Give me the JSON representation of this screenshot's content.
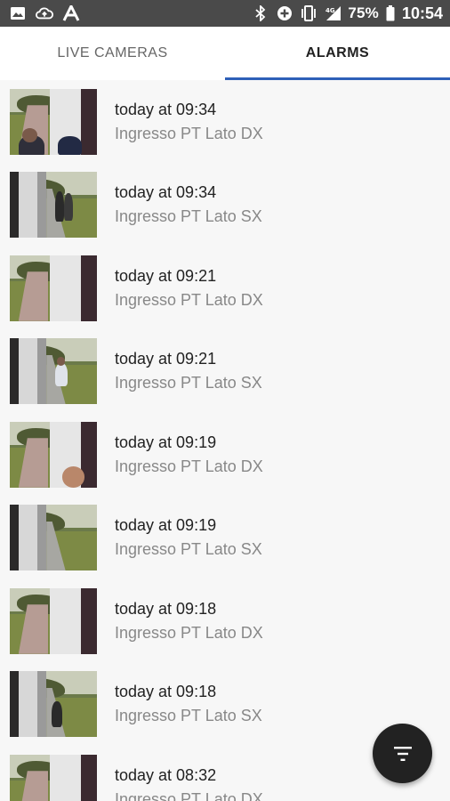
{
  "status_bar": {
    "battery_percent": "75%",
    "time": "10:54",
    "icons": [
      "image-icon",
      "cloud-upload-icon",
      "font-a-icon",
      "bluetooth-icon",
      "data-saver-icon",
      "vibrate-icon",
      "signal-4g-icon",
      "battery-icon"
    ]
  },
  "tabs": [
    {
      "label": "LIVE CAMERAS",
      "active": false
    },
    {
      "label": "ALARMS",
      "active": true
    }
  ],
  "alarms": [
    {
      "time": "today at 09:34",
      "camera": "Ingresso PT Lato DX",
      "side": "dx"
    },
    {
      "time": "today at 09:34",
      "camera": "Ingresso PT Lato SX",
      "side": "sx"
    },
    {
      "time": "today at 09:21",
      "camera": "Ingresso PT Lato DX",
      "side": "dx"
    },
    {
      "time": "today at 09:21",
      "camera": "Ingresso PT Lato SX",
      "side": "sx"
    },
    {
      "time": "today at 09:19",
      "camera": "Ingresso PT Lato DX",
      "side": "dx"
    },
    {
      "time": "today at 09:19",
      "camera": "Ingresso PT Lato SX",
      "side": "sx"
    },
    {
      "time": "today at 09:18",
      "camera": "Ingresso PT Lato DX",
      "side": "dx"
    },
    {
      "time": "today at 09:18",
      "camera": "Ingresso PT Lato SX",
      "side": "sx"
    },
    {
      "time": "today at 08:32",
      "camera": "Ingresso PT Lato DX",
      "side": "dx"
    }
  ],
  "fab": {
    "icon": "filter-icon"
  },
  "colors": {
    "accent": "#2e60b8",
    "status_bar": "#4a4a4a",
    "fab": "#222222"
  }
}
